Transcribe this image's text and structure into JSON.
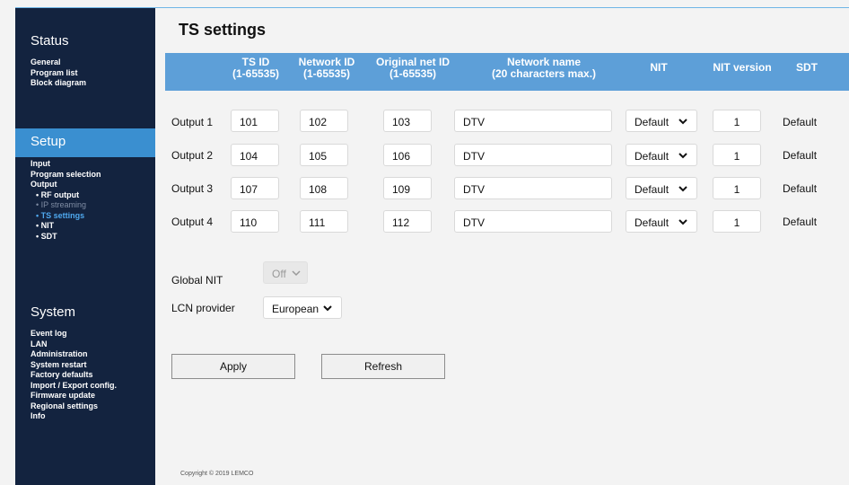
{
  "page_title": "TS settings",
  "sidebar": {
    "status": {
      "title": "Status",
      "items": [
        "General",
        "Program list",
        "Block diagram"
      ]
    },
    "setup": {
      "title": "Setup",
      "items": [
        "Input",
        "Program selection",
        "Output"
      ],
      "sub_items": [
        "• RF output",
        "• IP streaming",
        "• TS settings",
        "• NIT",
        "• SDT"
      ]
    },
    "system": {
      "title": "System",
      "items": [
        "Event log",
        "LAN",
        "Administration",
        "System restart",
        "Factory defaults",
        "Import / Export config.",
        "Firmware update",
        "Regional settings",
        "Info"
      ]
    }
  },
  "table": {
    "headers": {
      "ts_id": "TS ID",
      "ts_id_range": "(1-65535)",
      "network_id": "Network ID",
      "network_id_range": "(1-65535)",
      "orig_net_id": "Original net ID",
      "orig_net_id_range": "(1-65535)",
      "network_name": "Network name",
      "network_name_hint": "(20 characters max.)",
      "nit": "NIT",
      "nit_version": "NIT version",
      "sdt": "SDT"
    },
    "rows": [
      {
        "label": "Output 1",
        "ts_id": "101",
        "network_id": "102",
        "orig_net_id": "103",
        "network_name": "DTV",
        "nit": "Default",
        "nit_version": "1",
        "sdt": "Default"
      },
      {
        "label": "Output 2",
        "ts_id": "104",
        "network_id": "105",
        "orig_net_id": "106",
        "network_name": "DTV",
        "nit": "Default",
        "nit_version": "1",
        "sdt": "Default"
      },
      {
        "label": "Output 3",
        "ts_id": "107",
        "network_id": "108",
        "orig_net_id": "109",
        "network_name": "DTV",
        "nit": "Default",
        "nit_version": "1",
        "sdt": "Default"
      },
      {
        "label": "Output 4",
        "ts_id": "110",
        "network_id": "111",
        "orig_net_id": "112",
        "network_name": "DTV",
        "nit": "Default",
        "nit_version": "1",
        "sdt": "Default"
      }
    ]
  },
  "global_nit": {
    "label": "Global NIT",
    "value": "Off"
  },
  "lcn_provider": {
    "label": "LCN provider",
    "value": "European"
  },
  "buttons": {
    "apply": "Apply",
    "refresh": "Refresh"
  },
  "footer": {
    "copyright": "Copyright © 2019 LEMCO"
  },
  "colors": {
    "sidebar_bg": "#13233f",
    "accent": "#3a8fd0",
    "header_bg": "#5d9fd8",
    "active_item": "#4fa9ef"
  }
}
